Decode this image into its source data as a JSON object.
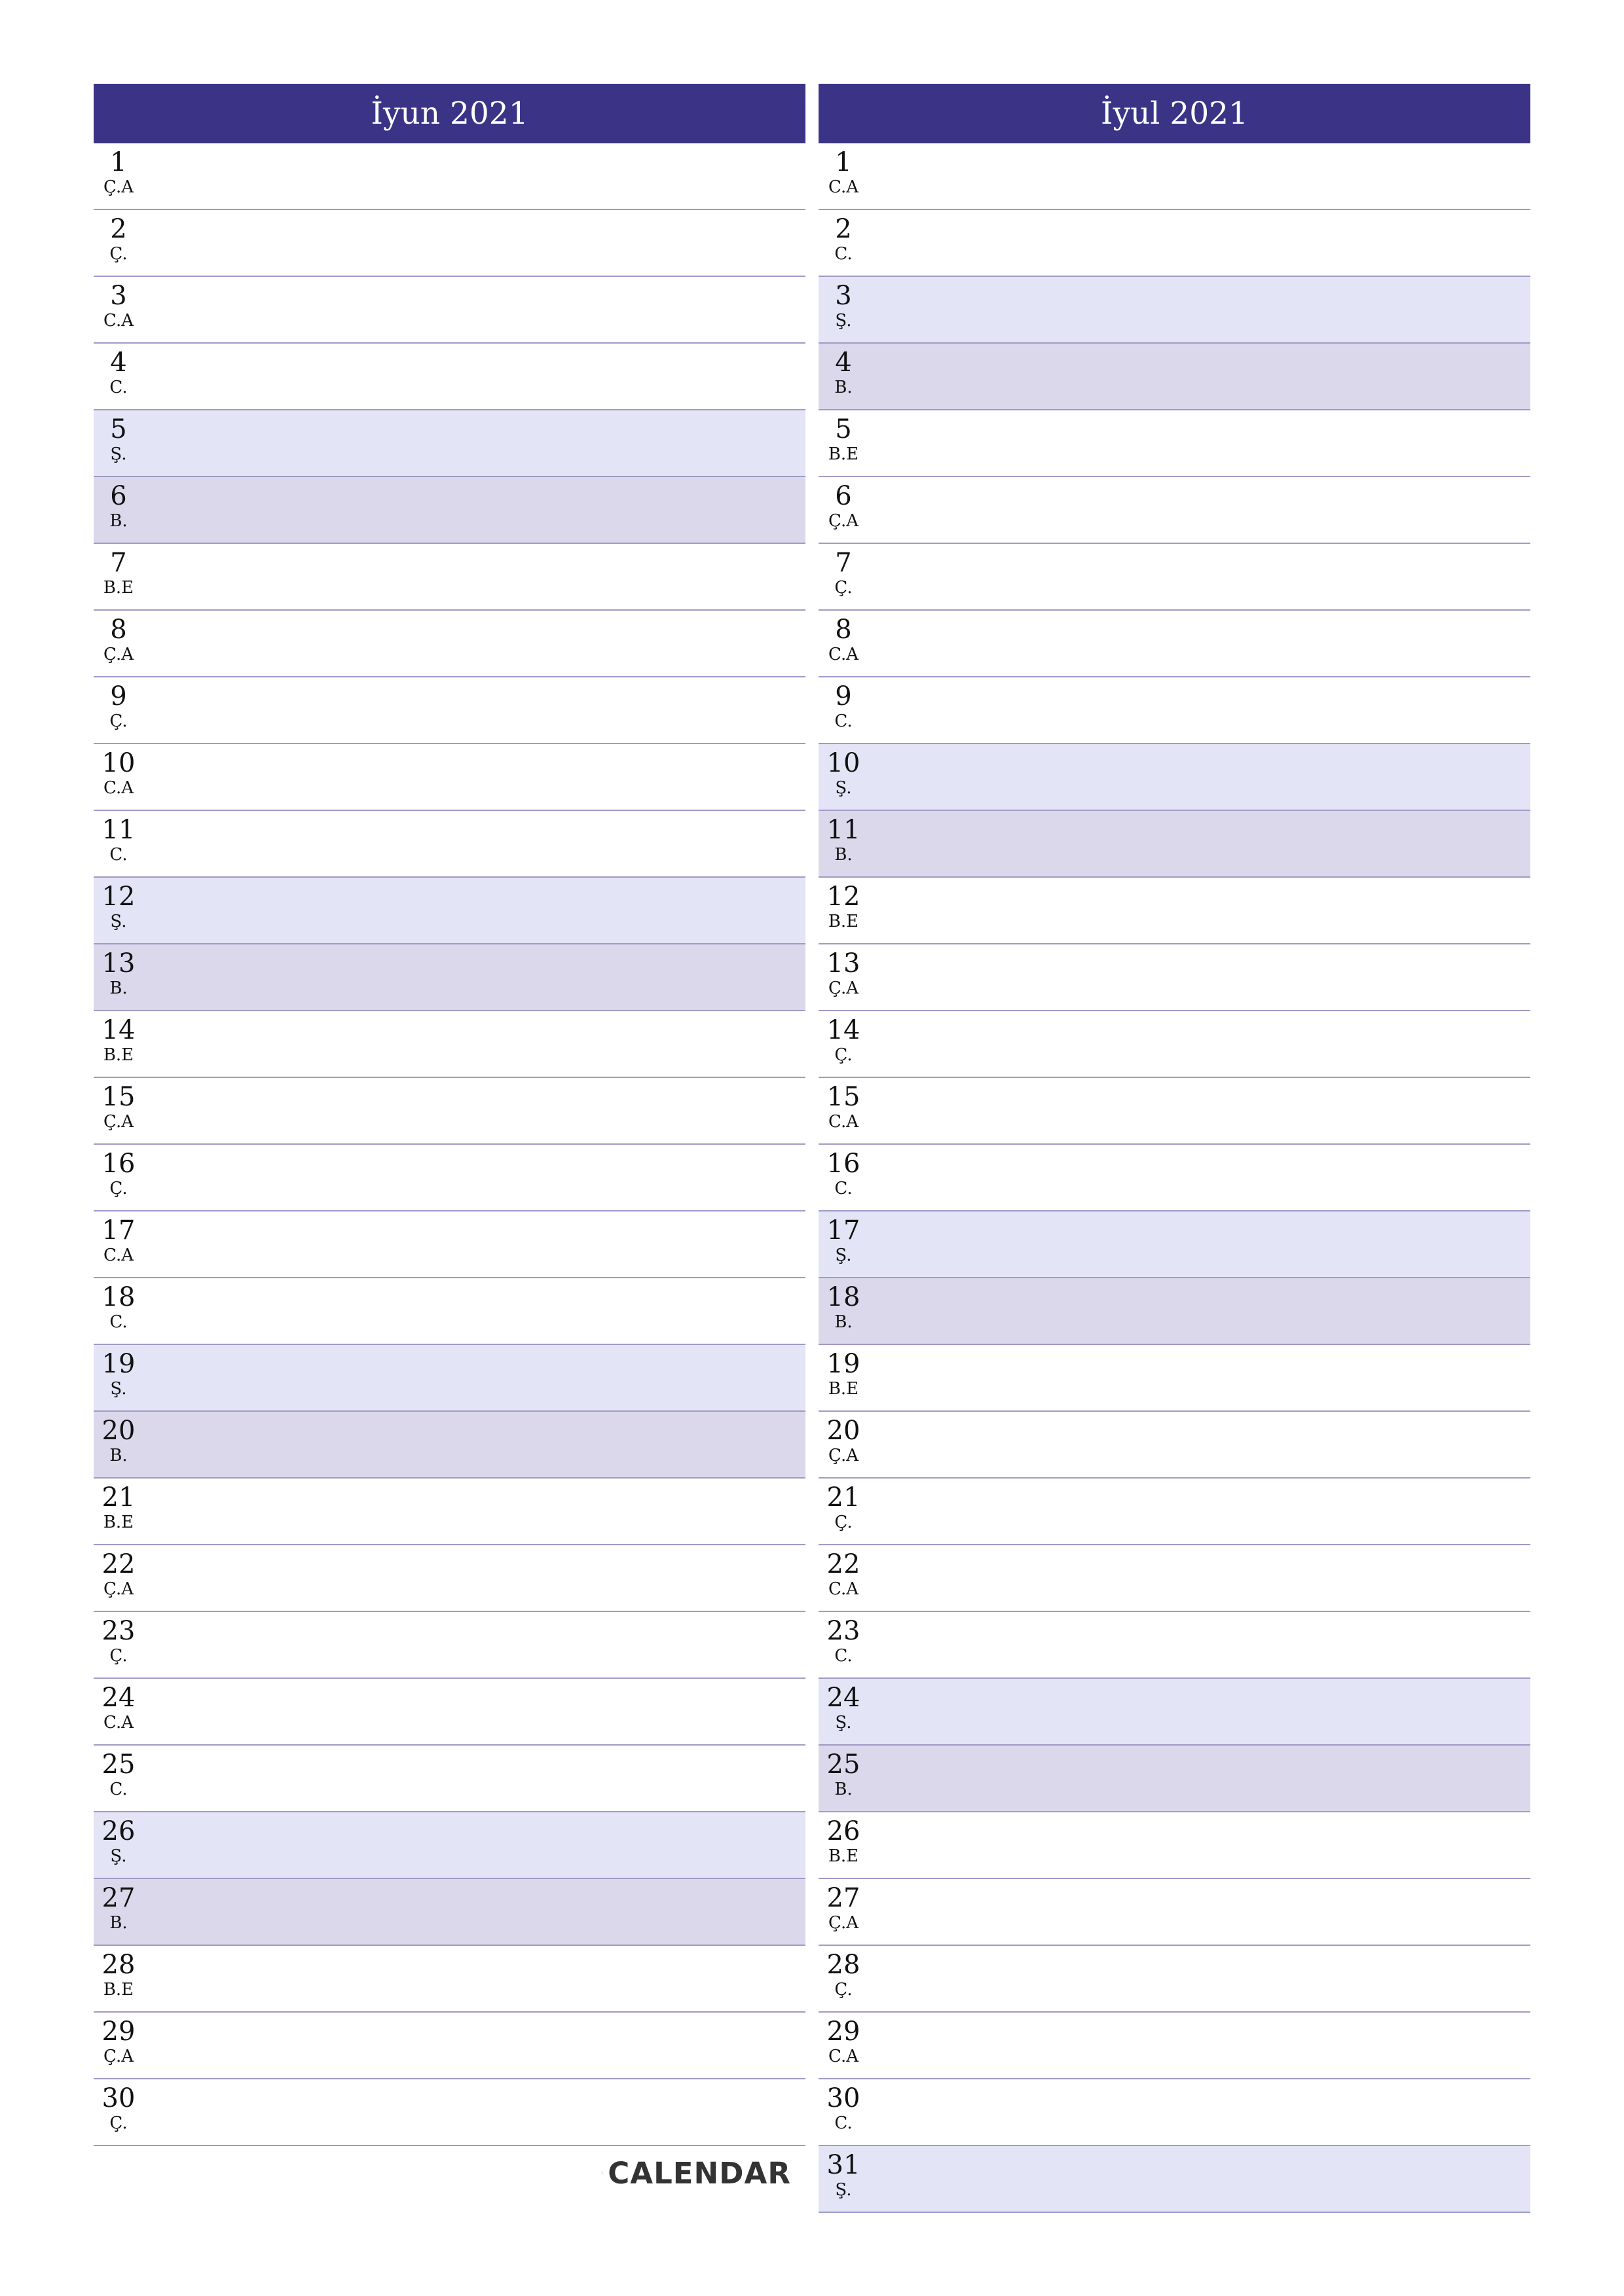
{
  "colors": {
    "header_bg": "#3A3386",
    "saturday_bg": "#E4E4F7",
    "sunday_bg": "#DCD8EC",
    "divider": "#9F9BC6",
    "logo_red": "#E8173F",
    "logo_blue": "#3A3399"
  },
  "logo": {
    "icon": "seven-logo-icon",
    "text": "CALENDAR"
  },
  "months": [
    {
      "title": "İyun 2021",
      "days": [
        {
          "num": "1",
          "name": "Ç.A",
          "type": "weekday"
        },
        {
          "num": "2",
          "name": "Ç.",
          "type": "weekday"
        },
        {
          "num": "3",
          "name": "C.A",
          "type": "weekday"
        },
        {
          "num": "4",
          "name": "C.",
          "type": "weekday"
        },
        {
          "num": "5",
          "name": "Ş.",
          "type": "sat"
        },
        {
          "num": "6",
          "name": "B.",
          "type": "sun"
        },
        {
          "num": "7",
          "name": "B.E",
          "type": "weekday"
        },
        {
          "num": "8",
          "name": "Ç.A",
          "type": "weekday"
        },
        {
          "num": "9",
          "name": "Ç.",
          "type": "weekday"
        },
        {
          "num": "10",
          "name": "C.A",
          "type": "weekday"
        },
        {
          "num": "11",
          "name": "C.",
          "type": "weekday"
        },
        {
          "num": "12",
          "name": "Ş.",
          "type": "sat"
        },
        {
          "num": "13",
          "name": "B.",
          "type": "sun"
        },
        {
          "num": "14",
          "name": "B.E",
          "type": "weekday"
        },
        {
          "num": "15",
          "name": "Ç.A",
          "type": "weekday"
        },
        {
          "num": "16",
          "name": "Ç.",
          "type": "weekday"
        },
        {
          "num": "17",
          "name": "C.A",
          "type": "weekday"
        },
        {
          "num": "18",
          "name": "C.",
          "type": "weekday"
        },
        {
          "num": "19",
          "name": "Ş.",
          "type": "sat"
        },
        {
          "num": "20",
          "name": "B.",
          "type": "sun"
        },
        {
          "num": "21",
          "name": "B.E",
          "type": "weekday"
        },
        {
          "num": "22",
          "name": "Ç.A",
          "type": "weekday"
        },
        {
          "num": "23",
          "name": "Ç.",
          "type": "weekday"
        },
        {
          "num": "24",
          "name": "C.A",
          "type": "weekday"
        },
        {
          "num": "25",
          "name": "C.",
          "type": "weekday"
        },
        {
          "num": "26",
          "name": "Ş.",
          "type": "sat"
        },
        {
          "num": "27",
          "name": "B.",
          "type": "sun"
        },
        {
          "num": "28",
          "name": "B.E",
          "type": "weekday"
        },
        {
          "num": "29",
          "name": "Ç.A",
          "type": "weekday"
        },
        {
          "num": "30",
          "name": "Ç.",
          "type": "weekday"
        }
      ]
    },
    {
      "title": "İyul 2021",
      "days": [
        {
          "num": "1",
          "name": "C.A",
          "type": "weekday"
        },
        {
          "num": "2",
          "name": "C.",
          "type": "weekday"
        },
        {
          "num": "3",
          "name": "Ş.",
          "type": "sat"
        },
        {
          "num": "4",
          "name": "B.",
          "type": "sun"
        },
        {
          "num": "5",
          "name": "B.E",
          "type": "weekday"
        },
        {
          "num": "6",
          "name": "Ç.A",
          "type": "weekday"
        },
        {
          "num": "7",
          "name": "Ç.",
          "type": "weekday"
        },
        {
          "num": "8",
          "name": "C.A",
          "type": "weekday"
        },
        {
          "num": "9",
          "name": "C.",
          "type": "weekday"
        },
        {
          "num": "10",
          "name": "Ş.",
          "type": "sat"
        },
        {
          "num": "11",
          "name": "B.",
          "type": "sun"
        },
        {
          "num": "12",
          "name": "B.E",
          "type": "weekday"
        },
        {
          "num": "13",
          "name": "Ç.A",
          "type": "weekday"
        },
        {
          "num": "14",
          "name": "Ç.",
          "type": "weekday"
        },
        {
          "num": "15",
          "name": "C.A",
          "type": "weekday"
        },
        {
          "num": "16",
          "name": "C.",
          "type": "weekday"
        },
        {
          "num": "17",
          "name": "Ş.",
          "type": "sat"
        },
        {
          "num": "18",
          "name": "B.",
          "type": "sun"
        },
        {
          "num": "19",
          "name": "B.E",
          "type": "weekday"
        },
        {
          "num": "20",
          "name": "Ç.A",
          "type": "weekday"
        },
        {
          "num": "21",
          "name": "Ç.",
          "type": "weekday"
        },
        {
          "num": "22",
          "name": "C.A",
          "type": "weekday"
        },
        {
          "num": "23",
          "name": "C.",
          "type": "weekday"
        },
        {
          "num": "24",
          "name": "Ş.",
          "type": "sat"
        },
        {
          "num": "25",
          "name": "B.",
          "type": "sun"
        },
        {
          "num": "26",
          "name": "B.E",
          "type": "weekday"
        },
        {
          "num": "27",
          "name": "Ç.A",
          "type": "weekday"
        },
        {
          "num": "28",
          "name": "Ç.",
          "type": "weekday"
        },
        {
          "num": "29",
          "name": "C.A",
          "type": "weekday"
        },
        {
          "num": "30",
          "name": "C.",
          "type": "weekday"
        },
        {
          "num": "31",
          "name": "Ş.",
          "type": "sat"
        }
      ]
    }
  ]
}
